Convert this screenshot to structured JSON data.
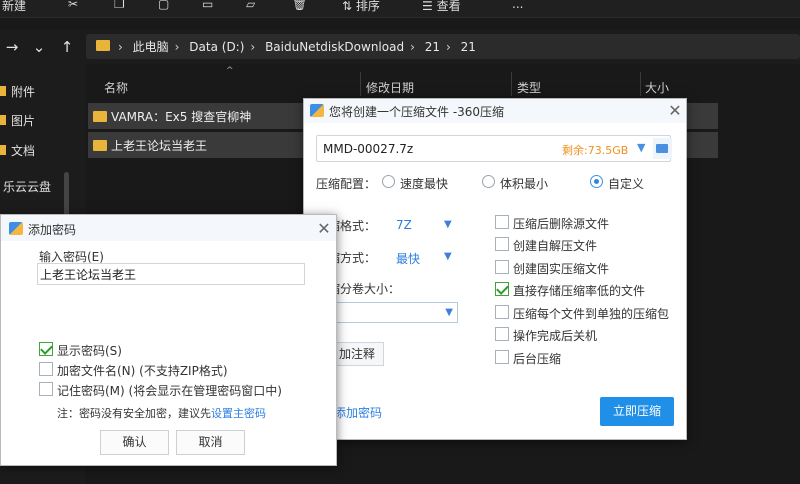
{
  "explorer": {
    "toolbar": {
      "new_label": "新建",
      "sort_label": "排序",
      "view_label": "查看",
      "more_label": "..."
    },
    "breadcrumbs": [
      "此电脑",
      "Data (D:)",
      "BaiduNetdiskDownload",
      "21",
      "21"
    ],
    "sidebar": [
      {
        "label": "附件"
      },
      {
        "label": "图片"
      },
      {
        "label": "文档"
      },
      {
        "label": "乐云云盘"
      }
    ],
    "columns": {
      "name": "名称",
      "date": "修改日期",
      "type": "类型",
      "size": "大小"
    },
    "files": [
      {
        "name": "VAMRA：Ex5 搜查官柳神"
      },
      {
        "name": "上老王论坛当老王"
      }
    ]
  },
  "archive_dialog": {
    "title": "您将创建一个压缩文件 -360压缩",
    "filename": "MMD-00027.7z",
    "free_space": "剩余:73.5GB",
    "config_label": "压缩配置：",
    "config_options": [
      "速度最快",
      "体积最小",
      "自定义"
    ],
    "config_selected": "自定义",
    "format_label": "缩格式：",
    "format_value": "7Z",
    "method_label": "缩方式：",
    "method_value": "最快",
    "split_label": "缩分卷大小：",
    "split_value": "",
    "comment_button": "加注释",
    "add_password_link": "添加密码",
    "ok_button": "立即压缩",
    "options": [
      {
        "label": "压缩后删除源文件",
        "checked": false
      },
      {
        "label": "创建自解压文件",
        "checked": false
      },
      {
        "label": "创建固实压缩文件",
        "checked": false
      },
      {
        "label": "直接存储压缩率低的文件",
        "checked": true
      },
      {
        "label": "压缩每个文件到单独的压缩包",
        "checked": false
      },
      {
        "label": "操作完成后关机",
        "checked": false
      },
      {
        "label": "后台压缩",
        "checked": false
      }
    ]
  },
  "password_dialog": {
    "title": "添加密码",
    "input_label": "输入密码(E)",
    "password_value": "上老王论坛当老王",
    "show_password": {
      "label": "显示密码(S)",
      "checked": true
    },
    "encrypt_names": {
      "label": "加密文件名(N) (不支持ZIP格式)",
      "checked": false
    },
    "remember": {
      "label": "记住密码(M) (将会显示在管理密码窗口中)",
      "checked": false
    },
    "note": "注：密码没有安全加密，建议先",
    "note_link": "设置主密码",
    "ok_button": "确认",
    "cancel_button": "取消"
  },
  "colors": {
    "accent": "#1f8fe8",
    "explorer_bg": "#191919",
    "folder": "#e8b43a",
    "orange": "#f0901e"
  }
}
